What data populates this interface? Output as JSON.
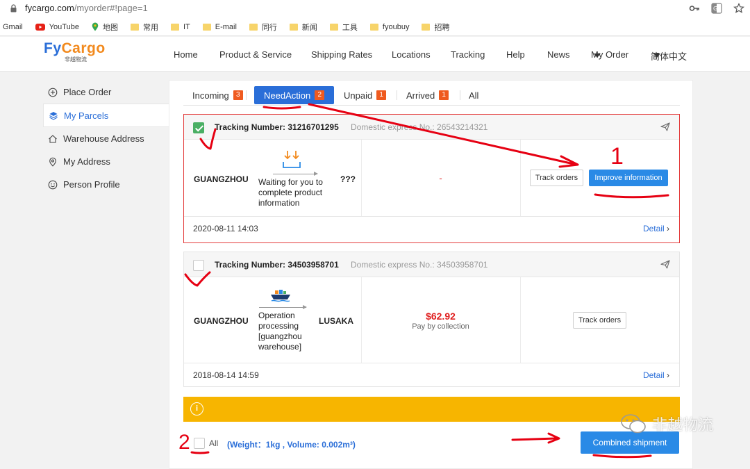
{
  "browser": {
    "url_host": "fycargo.com",
    "url_path": "/myorder#!page=1",
    "bookmarks": [
      {
        "label": "Gmail",
        "icon": "gmail-icon"
      },
      {
        "label": "YouTube",
        "icon": "youtube-icon"
      },
      {
        "label": "地图",
        "icon": "maps-icon"
      },
      {
        "label": "常用",
        "icon": "folder-icon"
      },
      {
        "label": "IT",
        "icon": "folder-icon"
      },
      {
        "label": "E-mail",
        "icon": "folder-icon"
      },
      {
        "label": "同行",
        "icon": "folder-icon"
      },
      {
        "label": "新闻",
        "icon": "folder-icon"
      },
      {
        "label": "工具",
        "icon": "folder-icon"
      },
      {
        "label": "fyoubuy",
        "icon": "folder-icon"
      },
      {
        "label": "招聘",
        "icon": "folder-icon"
      }
    ]
  },
  "header": {
    "logo_fy": "Fy",
    "logo_cargo": "Cargo",
    "logo_sub": "非越物流",
    "nav": [
      "Home",
      "Product & Service",
      "Shipping Rates",
      "Locations",
      "Tracking",
      "Help",
      "News",
      "My Order",
      "简体中文"
    ]
  },
  "sidebar": {
    "items": [
      {
        "label": "Place Order",
        "icon": "plus-circle-icon"
      },
      {
        "label": "My Parcels",
        "icon": "layers-icon"
      },
      {
        "label": "Warehouse Address",
        "icon": "home-icon"
      },
      {
        "label": "My Address",
        "icon": "location-pin-icon"
      },
      {
        "label": "Person Profile",
        "icon": "smiley-icon"
      }
    ]
  },
  "tabs": [
    {
      "label": "Incoming",
      "count": "3"
    },
    {
      "label": "NeedAction",
      "count": "2"
    },
    {
      "label": "Unpaid",
      "count": "1"
    },
    {
      "label": "Arrived",
      "count": "1"
    },
    {
      "label": "All",
      "count": ""
    }
  ],
  "orders": [
    {
      "checked": true,
      "tracking": "Tracking Number: 31216701295",
      "domestic": "Domestic express No.: 26543214321",
      "origin": "GUANGZHOU",
      "status": "Waiting for you to complete product information",
      "dest": "???",
      "amount": "-",
      "pay_note": "",
      "btn_track": "Track orders",
      "btn_improve": "Improve information",
      "date": "2020-08-11 14:03",
      "detail": "Detail"
    },
    {
      "checked": false,
      "tracking": "Tracking Number: 34503958701",
      "domestic": "Domestic express No.: 34503958701",
      "origin": "GUANGZHOU",
      "status": "Operation processing [guangzhou warehouse]",
      "dest": "LUSAKA",
      "amount": "$62.92",
      "pay_note": "Pay by collection",
      "btn_track": "Track orders",
      "date": "2018-08-14 14:59",
      "detail": "Detail"
    }
  ],
  "bottom": {
    "all_label": "All",
    "weight": "(Weight：1kg , Volume: 0.002m³)",
    "combine": "Combined shipment"
  },
  "annotations": {
    "label_1": "1",
    "label_2": "2",
    "color": "#e60012"
  },
  "watermark": "非越物流",
  "colors": {
    "accent": "#2a6ed8",
    "primary_button": "#2a8ae6",
    "badge": "#ef5a1f",
    "notice": "#f7b500",
    "price": "#e02020",
    "check": "#4aaf64"
  }
}
